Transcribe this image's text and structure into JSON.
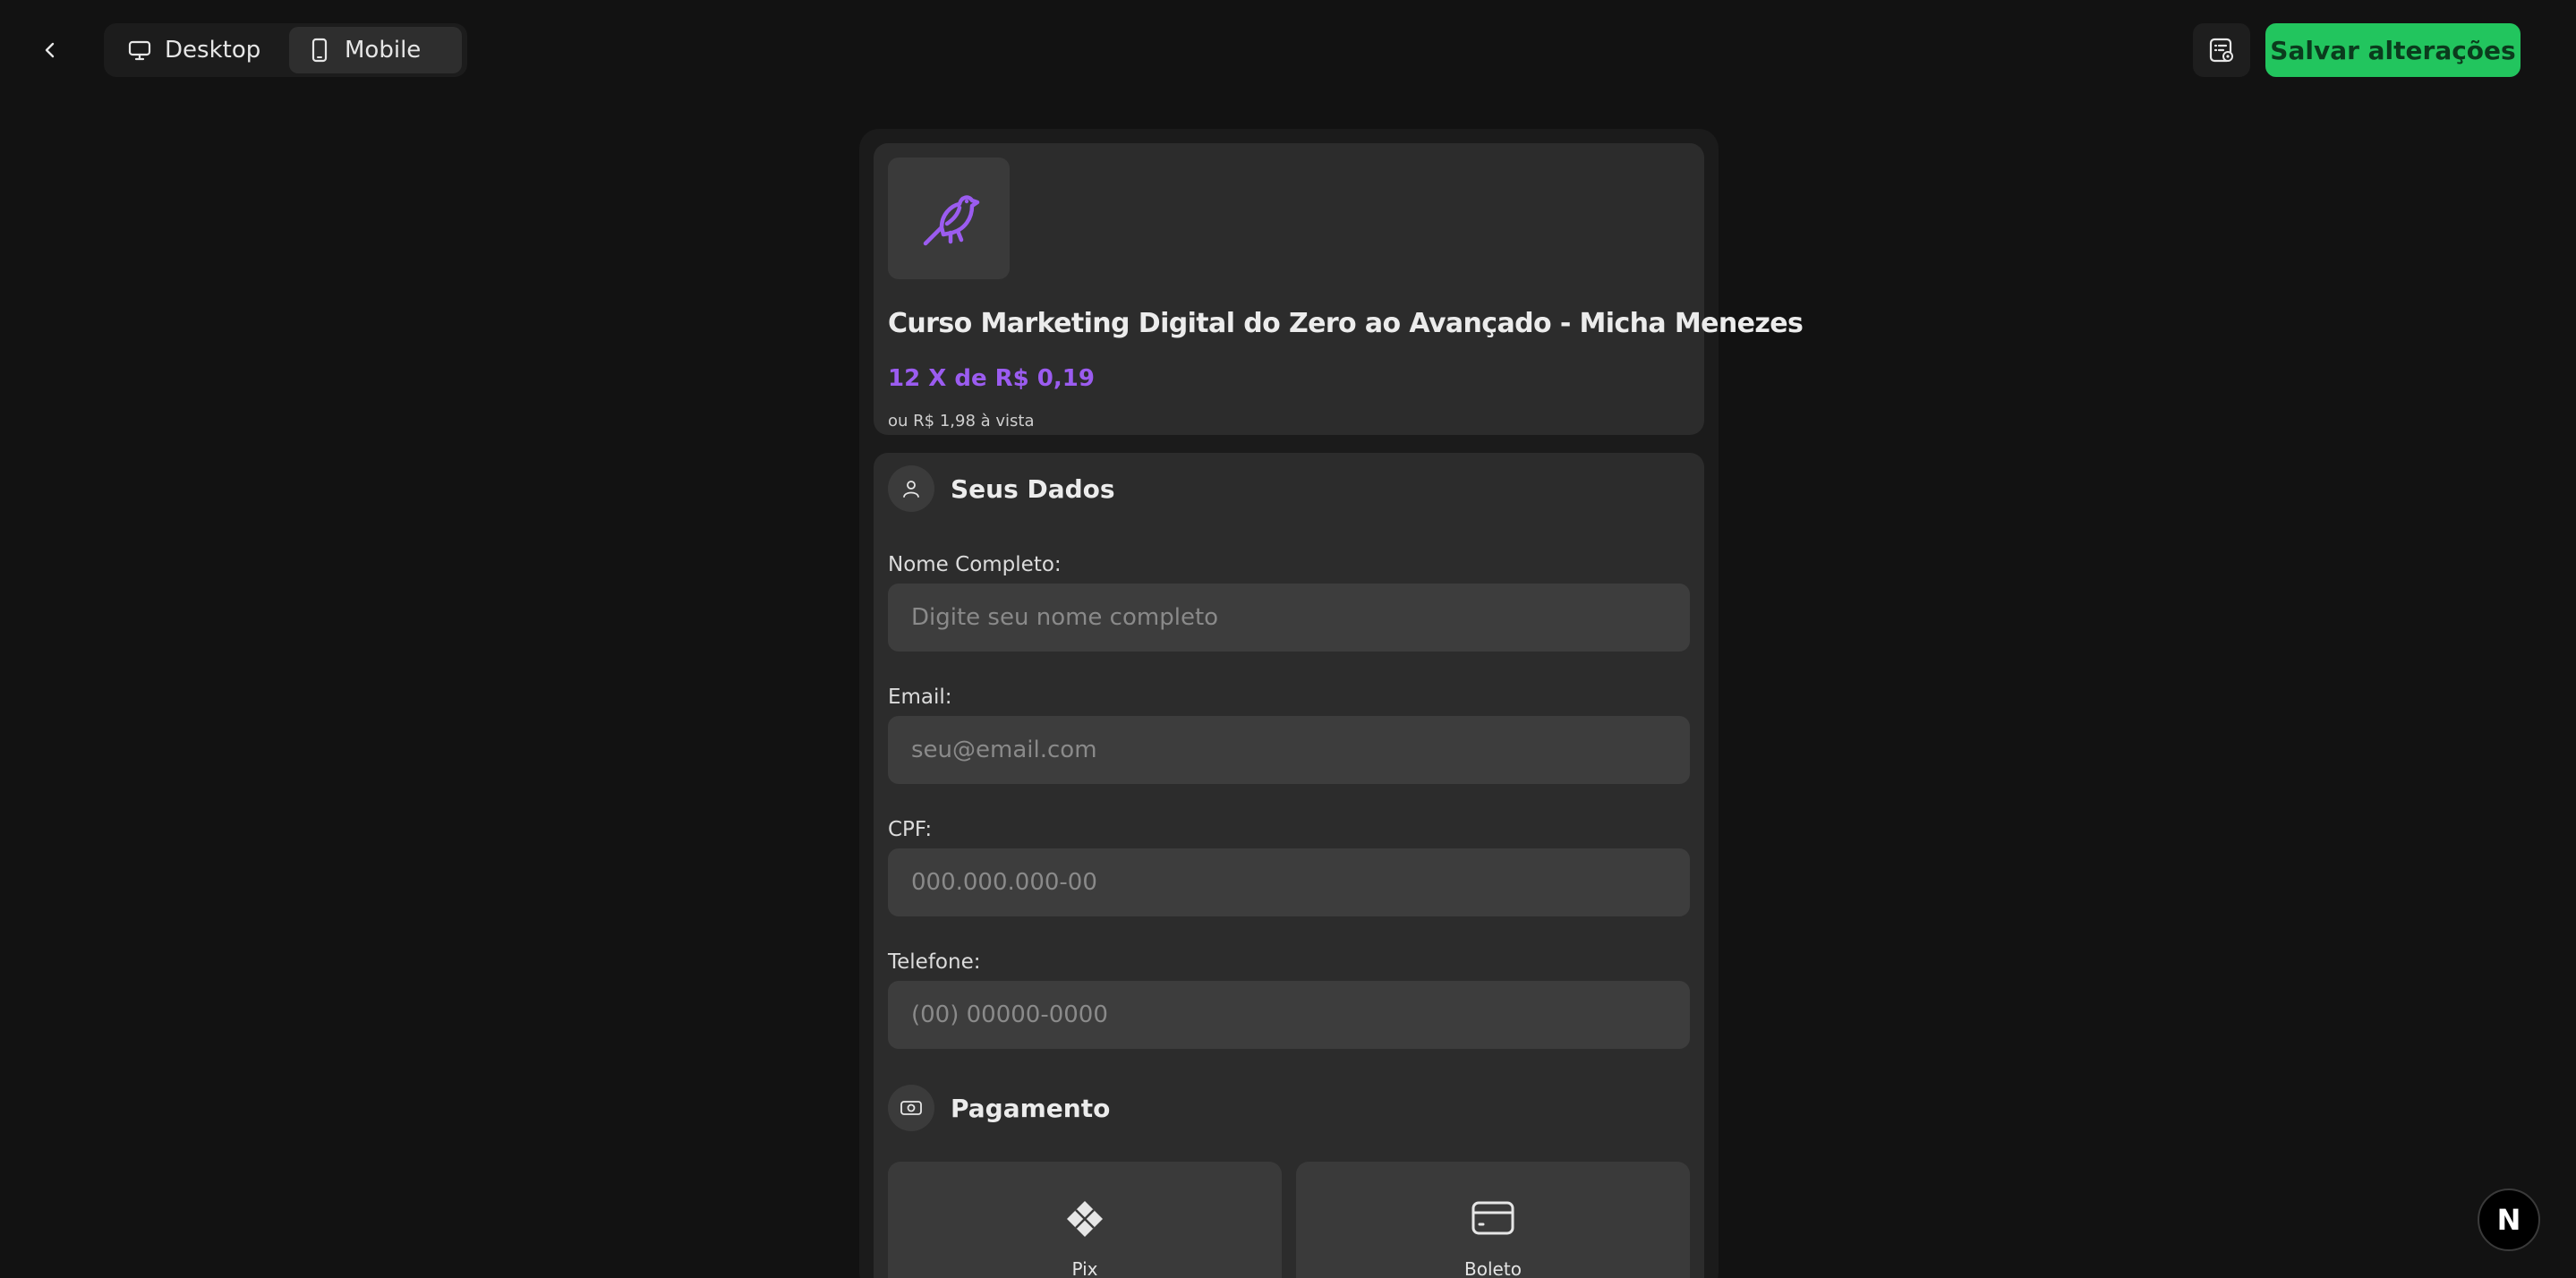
{
  "topbar": {
    "back_icon": "chevron-left-icon",
    "view_toggle": {
      "desktop_label": "Desktop",
      "mobile_label": "Mobile",
      "selected": "Mobile"
    },
    "preview_icon": "settings-list-icon",
    "save_label": "Salvar alterações"
  },
  "product": {
    "logo_icon": "bird-icon",
    "title": "Curso Marketing Digital do Zero ao Avançado - Micha Menezes",
    "price_installments": "12 X de R$ 0,19",
    "price_cash": "ou R$ 1,98 à vista"
  },
  "form": {
    "section_title": "Seus Dados",
    "fields": [
      {
        "label": "Nome Completo:",
        "placeholder": "Digite seu nome completo"
      },
      {
        "label": "Email:",
        "placeholder": "seu@email.com"
      },
      {
        "label": "CPF:",
        "placeholder": "000.000.000-00"
      },
      {
        "label": "Telefone:",
        "placeholder": "(00) 00000-0000"
      }
    ]
  },
  "payment": {
    "section_title": "Pagamento",
    "options": [
      {
        "label": "Pix",
        "icon": "pix-icon"
      },
      {
        "label": "Boleto",
        "icon": "card-icon"
      }
    ]
  },
  "badge": {
    "label": "N"
  },
  "colors": {
    "background": "#121212",
    "accent_green": "#22c55e",
    "accent_purple": "#9b5cf0",
    "card": "#2c2c2c",
    "input": "#3d3d3d"
  }
}
